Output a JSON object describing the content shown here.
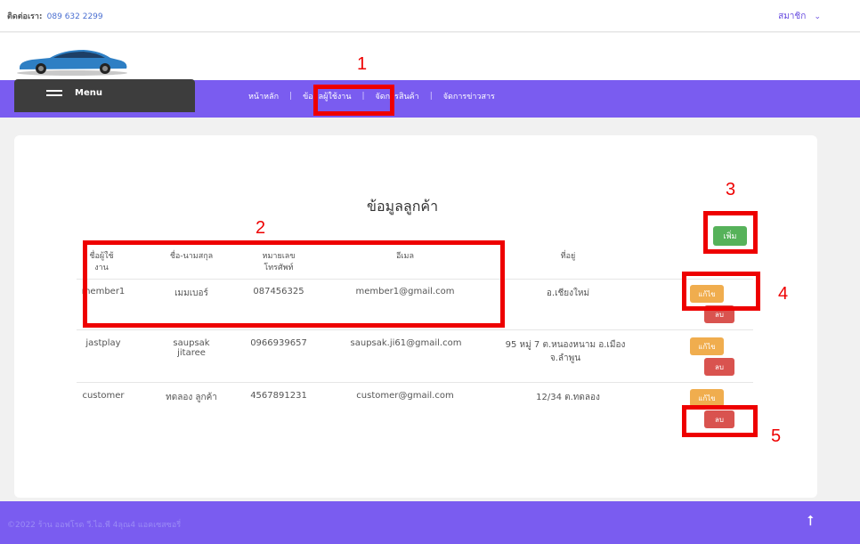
{
  "topbar": {
    "contact_label": "ติดต่อเรา:",
    "phone": "089 632 2299",
    "member_menu": "สมาชิก",
    "chevron": "⌄"
  },
  "nav": {
    "menu_label": "Menu",
    "links": [
      "หน้าหลัก",
      "ข้อมูลผู้ใช้งาน",
      "จัดการสินค้า",
      "จัดการข่าวสาร"
    ],
    "separator": "|"
  },
  "page": {
    "title": "ข้อมูลลูกค้า",
    "add_label": "เพิ่ม"
  },
  "table": {
    "headers": [
      "ชื่อผู้ใช้งาน",
      "ชื่อ-นามสกุล",
      "หมายเลขโทรศัพท์",
      "อีเมล",
      "ที่อยู่"
    ],
    "header_lines": [
      [
        "ชื่อผู้ใช้",
        "งาน"
      ],
      [
        "ชื่อ-นามสกุล"
      ],
      [
        "หมายเลข",
        "โทรศัพท์"
      ],
      [
        "อีเมล"
      ],
      [
        "ที่อยู่"
      ]
    ],
    "rows": [
      {
        "username": "member1",
        "fullname": [
          "เมมเบอร์"
        ],
        "phone": "087456325",
        "email": "member1@gmail.com",
        "address": [
          "อ.เชียงใหม่"
        ]
      },
      {
        "username": "jastplay",
        "fullname": [
          "saupsak",
          "jitaree"
        ],
        "phone": "0966939657",
        "email": "saupsak.ji61@gmail.com",
        "address": [
          "95 หมู่ 7 ต.หนองหนาม อ.เมือง",
          "จ.ลำพูน"
        ]
      },
      {
        "username": "customer",
        "fullname": [
          "ทดลอง ลูกค้า"
        ],
        "phone": "4567891231",
        "email": "customer@gmail.com",
        "address": [
          "12/34 ต.ทดลอง"
        ]
      }
    ],
    "edit_label": "แก้ไข",
    "delete_label": "ลบ"
  },
  "annotations": [
    "1",
    "2",
    "3",
    "4",
    "5"
  ],
  "footer": {
    "text": "©2022 ร้าน ออฟโรด วี.ไอ.พี 4ลุณ4 แอคเซสซอรี่",
    "up_icon": "⭡"
  },
  "colors": {
    "nav": "#7a5cf0",
    "menu_box": "#3d3d3d",
    "add": "#56b25a",
    "edit": "#f0ad4e",
    "delete": "#d9534f",
    "annotation": "#ee0000"
  }
}
